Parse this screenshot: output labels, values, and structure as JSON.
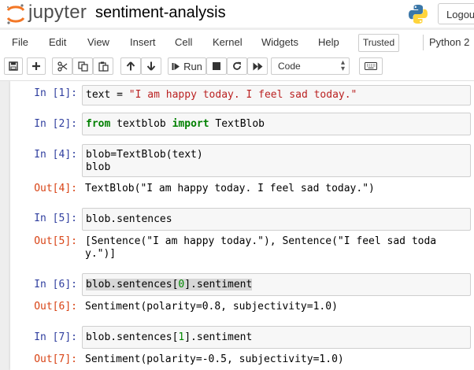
{
  "header": {
    "logo_text": "jupyter",
    "notebook_title": "sentiment-analysis",
    "logout_label": "Logout"
  },
  "menu": {
    "items": [
      "File",
      "Edit",
      "View",
      "Insert",
      "Cell",
      "Kernel",
      "Widgets",
      "Help"
    ],
    "trusted_label": "Trusted",
    "kernel_name": "Python 2"
  },
  "toolbar": {
    "run_label": "Run",
    "cell_type": "Code"
  },
  "cells": [
    {
      "in_prompt": "In [1]:",
      "code": [
        "text = ",
        "\"I am happy today. I feel sad today.\""
      ],
      "out_prompt": "",
      "output": ""
    },
    {
      "in_prompt": "In [2]:",
      "code": [
        "from",
        " textblob ",
        "import",
        " TextBlob"
      ],
      "out_prompt": "",
      "output": ""
    },
    {
      "in_prompt": "In [4]:",
      "code": [
        "blob=TextBlob(text)",
        "blob"
      ],
      "out_prompt": "Out[4]:",
      "output": "TextBlob(\"I am happy today. I feel sad today.\")"
    },
    {
      "in_prompt": "In [5]:",
      "code": [
        "blob.sentences"
      ],
      "out_prompt": "Out[5]:",
      "output": "[Sentence(\"I am happy today.\"), Sentence(\"I feel sad toda",
      "output_line2": "y.\")]"
    },
    {
      "in_prompt": "In [6]:",
      "code": [
        "blob.sentences[",
        "0",
        "].sentiment"
      ],
      "out_prompt": "Out[6]:",
      "output": "Sentiment(polarity=0.8, subjectivity=1.0)"
    },
    {
      "in_prompt": "In [7]:",
      "code": [
        "blob.sentences[",
        "1",
        "].sentiment"
      ],
      "out_prompt": "Out[7]:",
      "output": "Sentiment(polarity=-0.5, subjectivity=1.0)"
    }
  ],
  "colors": {
    "in_prompt": "#303f9f",
    "out_prompt": "#d84315",
    "string": "#ba2121",
    "keyword": "#008000"
  }
}
